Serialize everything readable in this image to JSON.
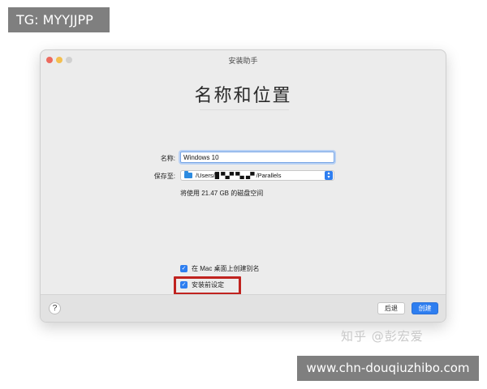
{
  "overlays": {
    "tg_watermark": "TG: MYYJJPP",
    "site_watermark": "www.chn-douqiuzhibo.com",
    "zhihu_watermark": "知乎 @彭宏爱"
  },
  "window": {
    "title": "安装助手",
    "heading": "名称和位置"
  },
  "form": {
    "name_label": "名称:",
    "name_value": "Windows 10",
    "save_to_label": "保存至:",
    "save_path": "/Users/█ ▀▄▀  ▀▄ ▄▀ /Parallels",
    "disk_usage_note": "将使用 21.47 GB 的磁盘空间"
  },
  "options": {
    "desktop_alias_label": "在 Mac 桌面上创建别名",
    "desktop_alias_checked": true,
    "customize_before_install_label": "安装前设定",
    "customize_before_install_checked": true
  },
  "footer": {
    "help_label": "?",
    "back_label": "后退",
    "create_label": "创建"
  },
  "colors": {
    "accent": "#2e7ef0",
    "highlight": "#c0231f"
  }
}
